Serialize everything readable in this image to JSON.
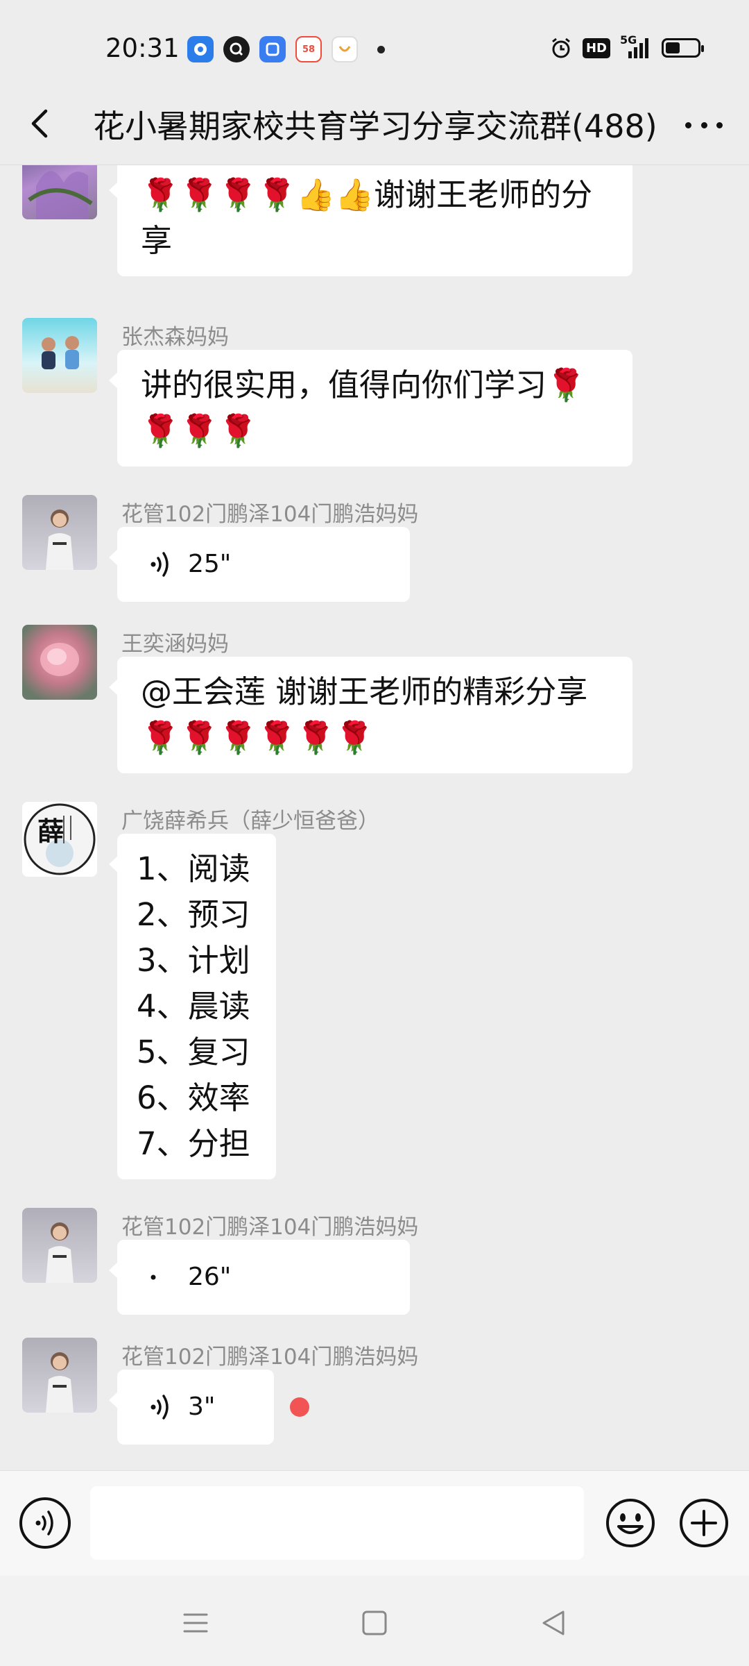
{
  "status_bar": {
    "time": "20:31",
    "apps": [
      {
        "icon": "browser-app-icon",
        "color": "#2b7de9",
        "label": ""
      },
      {
        "icon": "qq-app-icon",
        "color": "#1a1a1a",
        "label": ""
      },
      {
        "icon": "notes-app-icon",
        "color": "#3a7df0",
        "label": ""
      },
      {
        "icon": "58-app-icon",
        "color": "#f24a3b",
        "label": "58"
      },
      {
        "icon": "game-app-icon",
        "color": "#f0c030",
        "label": ""
      }
    ],
    "hd": "HD",
    "network": "5G",
    "battery_level": 0.45
  },
  "nav": {
    "title": "花小暑期家校共育学习分享交流群(488)"
  },
  "messages": [
    {
      "sender": "",
      "text": "🌹🌹🌹🌹👍👍谢谢王老师的分享",
      "lines": [
        "🌹🌹🌹🌹👍👍谢谢王老师的分",
        "享"
      ]
    },
    {
      "sender": "张杰森妈妈",
      "lines": [
        "讲的很实用，值得向你们学习🌹",
        "🌹🌹🌹"
      ]
    },
    {
      "sender": "花管102门鹏泽104门鹏浩妈妈",
      "voice": "25\""
    },
    {
      "sender": "王奕涵妈妈",
      "lines": [
        "@王会莲  谢谢王老师的精彩分享",
        "🌹🌹🌹🌹🌹🌹"
      ]
    },
    {
      "sender": "广饶薛希兵（薛少恒爸爸）",
      "avatar_text": "薛",
      "lines": [
        "1、阅读",
        "2、预习",
        "3、计划",
        "4、晨读",
        "5、复习",
        "6、效率",
        "7、分担"
      ]
    },
    {
      "sender": "花管102门鹏泽104门鹏浩妈妈",
      "voice": "26\""
    },
    {
      "sender": "花管102门鹏泽104门鹏浩妈妈",
      "voice": "3\"",
      "unread": true
    }
  ],
  "input": {
    "placeholder": ""
  },
  "colors": {
    "background": "#ededed",
    "bubble": "#ffffff",
    "unread_dot": "#f25354",
    "sender_name": "#8c8c8c"
  }
}
